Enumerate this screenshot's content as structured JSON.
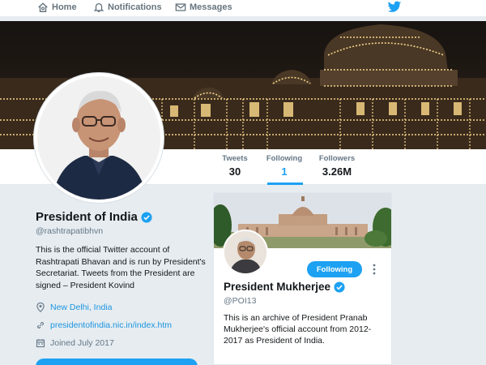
{
  "nav": {
    "home_label": "Home",
    "notifications_label": "Notifications",
    "messages_label": "Messages"
  },
  "stats": {
    "tweets_label": "Tweets",
    "tweets_value": "30",
    "following_label": "Following",
    "following_value": "1",
    "followers_label": "Followers",
    "followers_value": "3.26M",
    "active_tab": "Following"
  },
  "profile": {
    "name": "President of India",
    "handle": "@rashtrapatibhvn",
    "bio": "This is the official Twitter account of Rashtrapati Bhavan and is run by President's Secretariat. Tweets from the President are signed – President Kovind",
    "location": "New Delhi, India",
    "website": "presidentofindia.nic.in/index.htm",
    "joined": "Joined July 2017"
  },
  "following_card": {
    "name": "President Mukherjee",
    "handle": "@POI13",
    "bio": "This is an archive of President Pranab Mukherjee's official account from 2012-2017 as President of India.",
    "button_label": "Following"
  },
  "colors": {
    "accent": "#1da1f2",
    "link": "#1b95e0",
    "muted": "#657786",
    "background": "#e6ecf0"
  },
  "icons": [
    "home-icon",
    "bell-icon",
    "envelope-icon",
    "twitter-bird-icon",
    "verified-badge-icon",
    "location-pin-icon",
    "link-icon",
    "calendar-icon",
    "more-vertical-icon"
  ]
}
